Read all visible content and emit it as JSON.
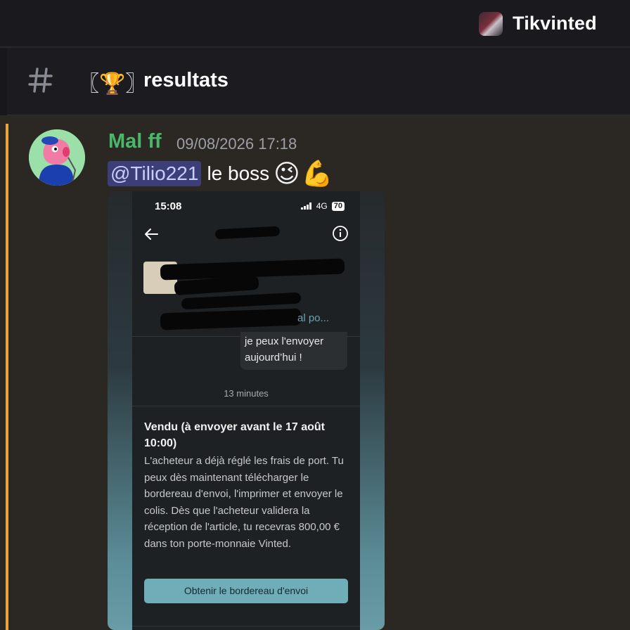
{
  "server": {
    "name": "Tikvinted"
  },
  "channel": {
    "emoji": "〖🏆〗",
    "name": "resultats"
  },
  "message": {
    "author": "Mal ff",
    "timestamp": "09/08/2026 17:18",
    "mention": "@Tilio221",
    "text": "le boss",
    "emojis": [
      "😉",
      "💪"
    ]
  },
  "attachment": {
    "status_time": "15:08",
    "status_network": "4G",
    "status_battery": "70",
    "link_fragment": "al po...",
    "bubble_text": "je peux l'envoyer aujourd’hui !",
    "time_separator": "13 minutes",
    "card_title": "Vendu (à envoyer avant le 17 août 10:00)",
    "card_body": "L'acheteur a déjà réglé les frais de port. Tu peux dès maintenant télécharger le bordereau d'envoi, l'imprimer et envoyer le colis. Dès que l'acheteur validera la réception de l'article, tu recevras 800,00 € dans ton porte-monnaie Vinted.",
    "button_label": "Obtenir le bordereau d'envoi"
  },
  "colors": {
    "author": "#49b86b",
    "mention_bg": "#3c3f77",
    "highlight": "#e8a53b",
    "button": "#6fadb9"
  }
}
